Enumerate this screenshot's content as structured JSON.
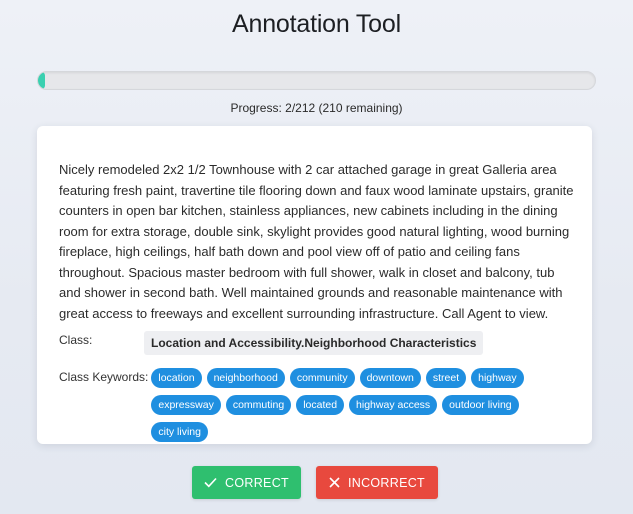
{
  "header": {
    "title": "Annotation Tool"
  },
  "progress": {
    "current": 2,
    "total": 212,
    "fraction": 0.0094,
    "text": "Progress: 2/212 (210 remaining)",
    "fill_color": "#3ad0b0"
  },
  "item": {
    "description": "Nicely remodeled 2x2 1/2 Townhouse with 2 car attached garage in great Galleria area featuring fresh paint, travertine tile flooring down and faux wood laminate upstairs, granite counters in open bar kitchen, stainless appliances, new cabinets including in the dining room for extra storage, double sink, skylight provides good natural lighting, wood burning fireplace, high ceilings, half bath down and pool view off of patio and ceiling fans throughout. Spacious master bedroom with full shower, walk in closet and balcony, tub and shower in second bath. Well maintained grounds and reasonable maintenance with great access to freeways and excellent surrounding infrastructure. Call Agent to view.",
    "class_label": "Class:",
    "class_value": "Location and Accessibility.Neighborhood Characteristics",
    "keywords_label": "Class Keywords:",
    "keywords": [
      "location",
      "neighborhood",
      "community",
      "downtown",
      "street",
      "highway",
      "expressway",
      "commuting",
      "located",
      "highway access",
      "outdoor living",
      "city living"
    ],
    "chip_color": "#1f8fe0"
  },
  "actions": {
    "correct_label": "CORRECT",
    "correct_icon": "check-icon",
    "correct_color": "#2fbf6f",
    "incorrect_label": "INCORRECT",
    "incorrect_icon": "x-icon",
    "incorrect_color": "#e8493e"
  }
}
